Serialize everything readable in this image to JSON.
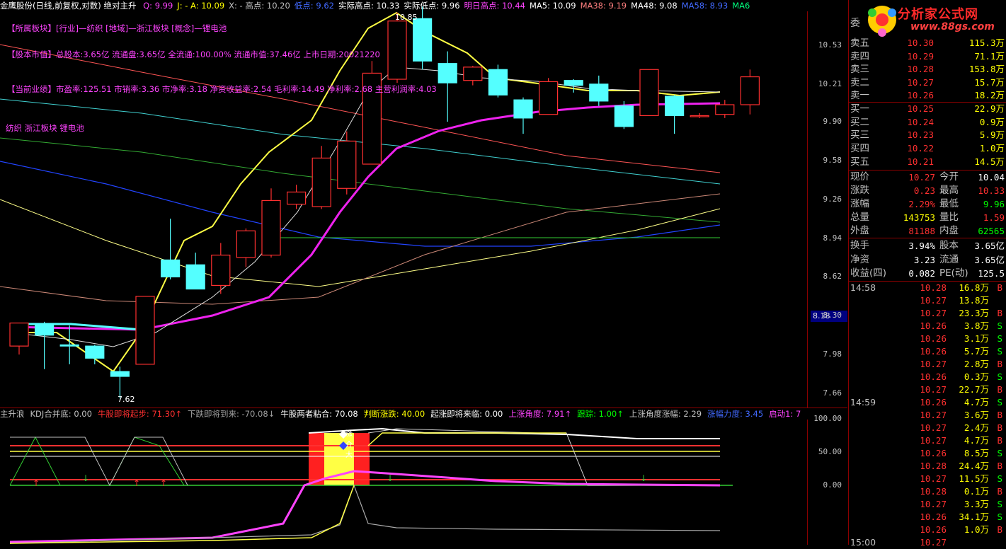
{
  "header": {
    "title": "金鹰股份(日线,前复权,对数) 绝对主升",
    "items": [
      {
        "text": "Q: 9.99",
        "color": "#ff44ff"
      },
      {
        "text": "J: - A: 10.09",
        "color": "#ffff00"
      },
      {
        "text": "X: - 高点: 10.20",
        "color": "#c0c0c0"
      },
      {
        "text": "低点: 9.62",
        "color": "#4169ff"
      },
      {
        "text": "实际高点: 10.33",
        "color": "#ffffff"
      },
      {
        "text": "实际低点: 9.96",
        "color": "#ffffff"
      },
      {
        "text": "明日高点: 10.44",
        "color": "#ff44ff"
      },
      {
        "text": "MA5: 10.09",
        "color": "#ffffff"
      },
      {
        "text": "MA38: 9.19",
        "color": "#ff7f7f"
      },
      {
        "text": "MA48: 9.08",
        "color": "#ffffff"
      },
      {
        "text": "MA58: 8.93",
        "color": "#4169ff"
      },
      {
        "text": "MA6",
        "color": "#00ff7f"
      }
    ]
  },
  "info": {
    "sector": "【所属板块】[行业]—纺织 [地域]—浙江板块 [概念]—锂电池",
    "capital": "【股本市值】总股本:3.65亿 流通盘:3.65亿 全流通:100.00% 流通市值:37.46亿 上市日期:20021220",
    "performance": "【当前业绩】市盈率:125.51 市销率:3.36 市净率:3.18 净资收益率:2.54 毛利率:14.49 净利率:2.68 主营利润率:4.03",
    "tags": "纺织 浙江板块 锂电池"
  },
  "chart_labels": {
    "high_marker": "10.85",
    "low_marker": "7.62",
    "side_price": "8.18"
  },
  "price_axis": [
    "10.53",
    "10.21",
    "9.90",
    "9.58",
    "9.26",
    "8.94",
    "8.62",
    "8.30",
    "7.98",
    "7.66"
  ],
  "indicator_bar": {
    "items": [
      {
        "text": "主升浪",
        "color": "#c0c0c0"
      },
      {
        "text": "KDJ合并底: 0.00",
        "color": "#c0c0c0"
      },
      {
        "text": "牛股即将起步: 71.30↑",
        "color": "#ff3030"
      },
      {
        "text": "下跌即将到来: -70.08↓",
        "color": "#a0a0a0"
      },
      {
        "text": "牛股两者粘合: 70.08",
        "color": "#ffffff"
      },
      {
        "text": "判断涨跌: 40.00",
        "color": "#ffff00"
      },
      {
        "text": "起涨即将来临: 0.00",
        "color": "#ffffff"
      },
      {
        "text": "上涨角度: 7.91↑",
        "color": "#ff44ff"
      },
      {
        "text": "跟踪: 1.00↑",
        "color": "#00ff00"
      },
      {
        "text": "上涨角度涨幅: 2.29",
        "color": "#c0c0c0"
      },
      {
        "text": "涨幅力度: 3.45",
        "color": "#4169ff"
      },
      {
        "text": "启动1: 7",
        "color": "#ff44ff"
      }
    ]
  },
  "indicator_axis": [
    "100.00",
    "50.00",
    "0.00"
  ],
  "indicator_marks": {
    "up": "涨",
    "mid": "介",
    "low": "大"
  },
  "logo": {
    "main": "分析家公式网",
    "sub": "www.88gs.com"
  },
  "order_book": {
    "sells": [
      {
        "label": "卖五",
        "price": "10.30",
        "vol": "115.3万"
      },
      {
        "label": "卖四",
        "price": "10.29",
        "vol": "71.1万"
      },
      {
        "label": "卖三",
        "price": "10.28",
        "vol": "153.8万"
      },
      {
        "label": "卖二",
        "price": "10.27",
        "vol": "15.7万"
      },
      {
        "label": "卖一",
        "price": "10.26",
        "vol": "18.2万"
      }
    ],
    "buys": [
      {
        "label": "买一",
        "price": "10.25",
        "vol": "22.9万"
      },
      {
        "label": "买二",
        "price": "10.24",
        "vol": "0.9万"
      },
      {
        "label": "买三",
        "price": "10.23",
        "vol": "5.9万"
      },
      {
        "label": "买四",
        "price": "10.22",
        "vol": "1.0万"
      },
      {
        "label": "买五",
        "price": "10.21",
        "vol": "14.5万"
      }
    ],
    "committee_label": "委"
  },
  "stats": [
    {
      "l1": "现价",
      "v1": "10.27",
      "c1": "#ff3030",
      "l2": "今开",
      "v2": "10.04",
      "c2": "#ffffff"
    },
    {
      "l1": "涨跌",
      "v1": "0.23",
      "c1": "#ff3030",
      "l2": "最高",
      "v2": "10.33",
      "c2": "#ff3030"
    },
    {
      "l1": "涨幅",
      "v1": "2.29%",
      "c1": "#ff3030",
      "l2": "最低",
      "v2": "9.96",
      "c2": "#00ff00"
    },
    {
      "l1": "总量",
      "v1": "143753",
      "c1": "#ffff00",
      "l2": "量比",
      "v2": "1.59",
      "c2": "#ff3030"
    },
    {
      "l1": "外盘",
      "v1": "81188",
      "c1": "#ff3030",
      "l2": "内盘",
      "v2": "62565",
      "c2": "#00ff00"
    },
    {
      "l1": "换手",
      "v1": "3.94%",
      "c1": "#ffffff",
      "l2": "股本",
      "v2": "3.65亿",
      "c2": "#ffffff"
    },
    {
      "l1": "净资",
      "v1": "3.23",
      "c1": "#ffffff",
      "l2": "流通",
      "v2": "3.65亿",
      "c2": "#ffffff"
    },
    {
      "l1": "收益(四)",
      "v1": "0.082",
      "c1": "#ffffff",
      "l2": "PE(动)",
      "v2": "125.5",
      "c2": "#ffffff"
    }
  ],
  "ticks": [
    {
      "t": "14:58",
      "p": "10.28",
      "v": "16.8万",
      "d": "B"
    },
    {
      "t": "",
      "p": "10.27",
      "v": "13.8万",
      "d": ""
    },
    {
      "t": "",
      "p": "10.27",
      "v": "23.3万",
      "d": "B"
    },
    {
      "t": "",
      "p": "10.26",
      "v": "3.8万",
      "d": "S"
    },
    {
      "t": "",
      "p": "10.26",
      "v": "3.1万",
      "d": "S"
    },
    {
      "t": "",
      "p": "10.26",
      "v": "5.7万",
      "d": "S"
    },
    {
      "t": "",
      "p": "10.27",
      "v": "2.8万",
      "d": "B"
    },
    {
      "t": "",
      "p": "10.26",
      "v": "0.3万",
      "d": "S"
    },
    {
      "t": "",
      "p": "10.27",
      "v": "22.7万",
      "d": "B"
    },
    {
      "t": "14:59",
      "p": "10.26",
      "v": "4.7万",
      "d": "S"
    },
    {
      "t": "",
      "p": "10.27",
      "v": "3.6万",
      "d": "B"
    },
    {
      "t": "",
      "p": "10.27",
      "v": "2.4万",
      "d": "B"
    },
    {
      "t": "",
      "p": "10.27",
      "v": "4.7万",
      "d": "B"
    },
    {
      "t": "",
      "p": "10.26",
      "v": "8.5万",
      "d": "S"
    },
    {
      "t": "",
      "p": "10.28",
      "v": "24.4万",
      "d": "B"
    },
    {
      "t": "",
      "p": "10.27",
      "v": "11.5万",
      "d": "S"
    },
    {
      "t": "",
      "p": "10.28",
      "v": "0.1万",
      "d": "B"
    },
    {
      "t": "",
      "p": "10.27",
      "v": "3.3万",
      "d": "S"
    },
    {
      "t": "",
      "p": "10.26",
      "v": "34.1万",
      "d": "S"
    },
    {
      "t": "",
      "p": "10.26",
      "v": "1.0万",
      "d": "B"
    },
    {
      "t": "15:00",
      "p": "10.27",
      "v": "",
      "d": ""
    }
  ],
  "candles": [
    {
      "o": 8.05,
      "c": 8.24,
      "h": 8.24,
      "l": 7.98
    },
    {
      "o": 8.22,
      "c": 8.14,
      "h": 8.25,
      "l": 7.86
    },
    {
      "o": 8.06,
      "c": 8.05,
      "h": 8.22,
      "l": 7.9
    },
    {
      "o": 8.05,
      "c": 7.95,
      "h": 8.06,
      "l": 7.9
    },
    {
      "o": 7.84,
      "c": 7.8,
      "h": 7.88,
      "l": 7.62
    },
    {
      "o": 7.9,
      "c": 8.46,
      "h": 8.46,
      "l": 7.9
    },
    {
      "o": 8.76,
      "c": 8.62,
      "h": 9.1,
      "l": 8.6
    },
    {
      "o": 8.72,
      "c": 8.52,
      "h": 8.82,
      "l": 8.52
    },
    {
      "o": 8.55,
      "c": 8.8,
      "h": 8.9,
      "l": 8.48
    },
    {
      "o": 8.78,
      "c": 9.0,
      "h": 9.02,
      "l": 8.7
    },
    {
      "o": 8.8,
      "c": 9.25,
      "h": 9.35,
      "l": 8.78
    },
    {
      "o": 9.22,
      "c": 9.32,
      "h": 9.38,
      "l": 9.18
    },
    {
      "o": 9.2,
      "c": 9.6,
      "h": 9.7,
      "l": 9.18
    },
    {
      "o": 9.35,
      "c": 9.74,
      "h": 9.82,
      "l": 9.3
    },
    {
      "o": 9.55,
      "c": 10.3,
      "h": 10.4,
      "l": 9.55
    },
    {
      "o": 10.25,
      "c": 10.73,
      "h": 10.8,
      "l": 10.22
    },
    {
      "o": 10.75,
      "c": 10.4,
      "h": 10.85,
      "l": 10.33
    },
    {
      "o": 10.38,
      "c": 10.22,
      "h": 10.48,
      "l": 9.9
    },
    {
      "o": 10.24,
      "c": 10.35,
      "h": 10.36,
      "l": 10.2
    },
    {
      "o": 10.33,
      "c": 10.12,
      "h": 10.37,
      "l": 10.1
    },
    {
      "o": 10.08,
      "c": 9.93,
      "h": 10.1,
      "l": 9.8
    },
    {
      "o": 9.96,
      "c": 10.23,
      "h": 10.26,
      "l": 9.96
    },
    {
      "o": 10.24,
      "c": 10.2,
      "h": 10.25,
      "l": 10.14
    },
    {
      "o": 10.21,
      "c": 10.07,
      "h": 10.28,
      "l": 10.03
    },
    {
      "o": 10.03,
      "c": 9.86,
      "h": 10.07,
      "l": 9.84
    },
    {
      "o": 9.95,
      "c": 10.33,
      "h": 10.33,
      "l": 9.95
    },
    {
      "o": 10.11,
      "c": 9.95,
      "h": 10.12,
      "l": 9.8
    },
    {
      "o": 9.95,
      "c": 9.95,
      "h": 9.97,
      "l": 9.93
    },
    {
      "o": 9.96,
      "c": 10.04,
      "h": 10.08,
      "l": 9.93
    },
    {
      "o": 10.04,
      "c": 10.27,
      "h": 10.33,
      "l": 9.96
    }
  ],
  "colors": {
    "up": "#ff3030",
    "down": "#54ffff",
    "yellow_line": "#ffff44",
    "magenta_line": "#ee22ee",
    "white_line": "#ffffff"
  }
}
